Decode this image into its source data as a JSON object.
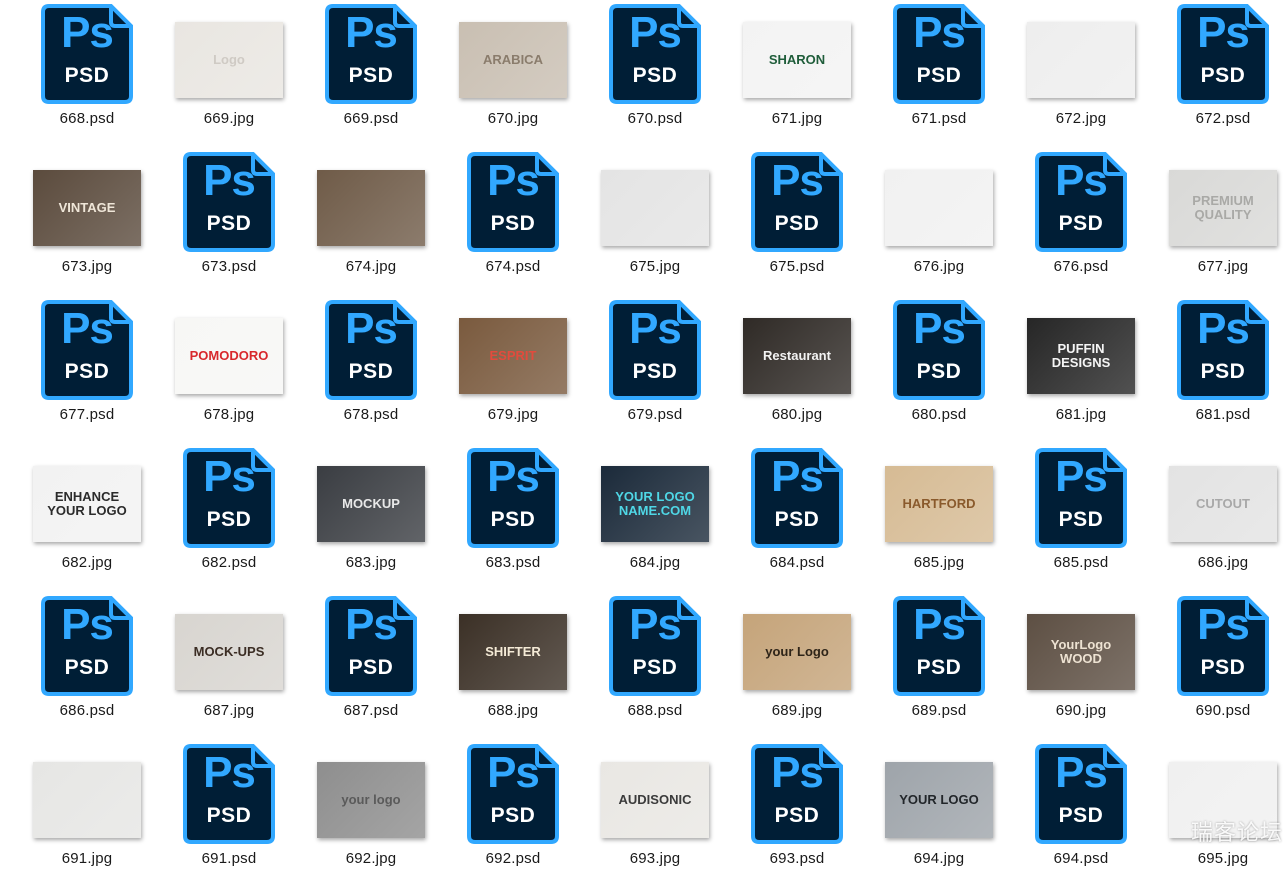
{
  "files": [
    {
      "name": "668.psd",
      "type": "psd"
    },
    {
      "name": "669.jpg",
      "type": "jpg",
      "thumb": {
        "bg": "#e9e6e1",
        "fg": "#cfcac4",
        "text": "Logo"
      }
    },
    {
      "name": "669.psd",
      "type": "psd"
    },
    {
      "name": "670.jpg",
      "type": "jpg",
      "thumb": {
        "bg": "#c9bfb2",
        "fg": "#8a7c6c",
        "text": "ARABICA"
      }
    },
    {
      "name": "670.psd",
      "type": "psd"
    },
    {
      "name": "671.jpg",
      "type": "jpg",
      "thumb": {
        "bg": "#f3f3f3",
        "fg": "#1f5d3a",
        "text": "SHARON"
      }
    },
    {
      "name": "671.psd",
      "type": "psd"
    },
    {
      "name": "672.jpg",
      "type": "jpg",
      "thumb": {
        "bg": "#eeeeee",
        "fg": "#d4d4d4",
        "text": ""
      }
    },
    {
      "name": "672.psd",
      "type": "psd"
    },
    {
      "name": "673.jpg",
      "type": "jpg",
      "thumb": {
        "bg": "#5b4b3d",
        "fg": "#efe6d8",
        "text": "VINTAGE"
      }
    },
    {
      "name": "673.psd",
      "type": "psd"
    },
    {
      "name": "674.jpg",
      "type": "jpg",
      "thumb": {
        "bg": "#6f5b48",
        "fg": "#3a2c20",
        "text": ""
      }
    },
    {
      "name": "674.psd",
      "type": "psd"
    },
    {
      "name": "675.jpg",
      "type": "jpg",
      "thumb": {
        "bg": "#e4e4e4",
        "fg": "#e2224a",
        "text": ""
      }
    },
    {
      "name": "675.psd",
      "type": "psd"
    },
    {
      "name": "676.jpg",
      "type": "jpg",
      "thumb": {
        "bg": "#f1f1f1",
        "fg": "#a3141c",
        "text": ""
      }
    },
    {
      "name": "676.psd",
      "type": "psd"
    },
    {
      "name": "677.jpg",
      "type": "jpg",
      "thumb": {
        "bg": "#d9d9d7",
        "fg": "#a9a9a6",
        "text": "PREMIUM\nQUALITY"
      }
    },
    {
      "name": "677.psd",
      "type": "psd"
    },
    {
      "name": "678.jpg",
      "type": "jpg",
      "thumb": {
        "bg": "#f7f7f5",
        "fg": "#d8282c",
        "text": "POMODORO"
      }
    },
    {
      "name": "678.psd",
      "type": "psd"
    },
    {
      "name": "679.jpg",
      "type": "jpg",
      "thumb": {
        "bg": "#7a5a3e",
        "fg": "#e24b3d",
        "text": "ESPRIT"
      }
    },
    {
      "name": "679.psd",
      "type": "psd"
    },
    {
      "name": "680.jpg",
      "type": "jpg",
      "thumb": {
        "bg": "#2f2a26",
        "fg": "#f2f2f2",
        "text": "Restaurant"
      }
    },
    {
      "name": "680.psd",
      "type": "psd"
    },
    {
      "name": "681.jpg",
      "type": "jpg",
      "thumb": {
        "bg": "#262626",
        "fg": "#f5f5f5",
        "text": "PUFFIN\nDESIGNS"
      }
    },
    {
      "name": "681.psd",
      "type": "psd"
    },
    {
      "name": "682.jpg",
      "type": "jpg",
      "thumb": {
        "bg": "#f2f2f2",
        "fg": "#2b2b2b",
        "text": "ENHANCE\nYOUR LOGO"
      }
    },
    {
      "name": "682.psd",
      "type": "psd"
    },
    {
      "name": "683.jpg",
      "type": "jpg",
      "thumb": {
        "bg": "#3a3d42",
        "fg": "#e8e8e8",
        "text": "MOCKUP"
      }
    },
    {
      "name": "683.psd",
      "type": "psd"
    },
    {
      "name": "684.jpg",
      "type": "jpg",
      "thumb": {
        "bg": "#1b2a3a",
        "fg": "#4fd7e6",
        "text": "YOUR LOGO\nNAME.COM"
      }
    },
    {
      "name": "684.psd",
      "type": "psd"
    },
    {
      "name": "685.jpg",
      "type": "jpg",
      "thumb": {
        "bg": "#d6bb94",
        "fg": "#8a5a2c",
        "text": "HARTFORD"
      }
    },
    {
      "name": "685.psd",
      "type": "psd"
    },
    {
      "name": "686.jpg",
      "type": "jpg",
      "thumb": {
        "bg": "#e3e3e3",
        "fg": "#a8a8a8",
        "text": "CUTOUT"
      }
    },
    {
      "name": "686.psd",
      "type": "psd"
    },
    {
      "name": "687.jpg",
      "type": "jpg",
      "thumb": {
        "bg": "#d8d5d0",
        "fg": "#3b2d24",
        "text": "MOCK-UPS"
      }
    },
    {
      "name": "687.psd",
      "type": "psd"
    },
    {
      "name": "688.jpg",
      "type": "jpg",
      "thumb": {
        "bg": "#3b3026",
        "fg": "#f4ead6",
        "text": "SHIFTER"
      }
    },
    {
      "name": "688.psd",
      "type": "psd"
    },
    {
      "name": "689.jpg",
      "type": "jpg",
      "thumb": {
        "bg": "#c5a47a",
        "fg": "#2e2418",
        "text": "your Logo"
      }
    },
    {
      "name": "689.psd",
      "type": "psd"
    },
    {
      "name": "690.jpg",
      "type": "jpg",
      "thumb": {
        "bg": "#5d4f43",
        "fg": "#ede2d2",
        "text": "YourLogo\nWOOD"
      }
    },
    {
      "name": "690.psd",
      "type": "psd"
    },
    {
      "name": "691.jpg",
      "type": "jpg",
      "thumb": {
        "bg": "#e6e6e4",
        "fg": "#8a7a55",
        "text": ""
      }
    },
    {
      "name": "691.psd",
      "type": "psd"
    },
    {
      "name": "692.jpg",
      "type": "jpg",
      "thumb": {
        "bg": "#8e8e8e",
        "fg": "#5a5a5a",
        "text": "your logo"
      }
    },
    {
      "name": "692.psd",
      "type": "psd"
    },
    {
      "name": "693.jpg",
      "type": "jpg",
      "thumb": {
        "bg": "#e9e7e3",
        "fg": "#3b3b3b",
        "text": "AUDISONIC"
      }
    },
    {
      "name": "693.psd",
      "type": "psd"
    },
    {
      "name": "694.jpg",
      "type": "jpg",
      "thumb": {
        "bg": "#9ea4aa",
        "fg": "#22262a",
        "text": "YOUR LOGO"
      }
    },
    {
      "name": "694.psd",
      "type": "psd"
    },
    {
      "name": "695.jpg",
      "type": "jpg",
      "thumb": {
        "bg": "#f0f0f0",
        "fg": "#d9d9d9",
        "text": ""
      }
    }
  ],
  "psd_icon": {
    "ps_label": "Ps",
    "sub_label": "PSD",
    "body_color": "#001e36",
    "accent_color": "#31a8ff"
  },
  "watermark": "瑞客论坛"
}
